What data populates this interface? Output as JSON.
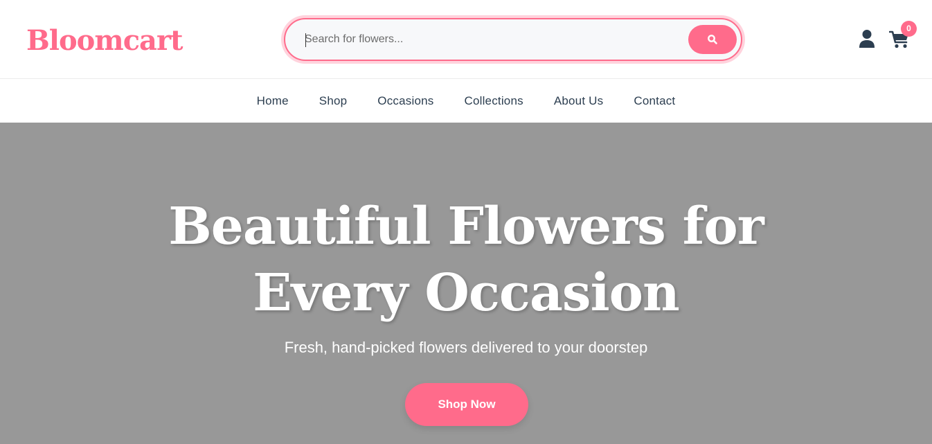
{
  "brand": {
    "logo": "Bloomcart",
    "accent_color": "#ff6b8b"
  },
  "search": {
    "placeholder": "Search for flowers...",
    "value": "",
    "button_icon": "search-icon"
  },
  "header_icons": {
    "user": "user-icon",
    "cart": "cart-icon",
    "cart_count": "0"
  },
  "nav": {
    "items": [
      {
        "label": "Home"
      },
      {
        "label": "Shop"
      },
      {
        "label": "Occasions"
      },
      {
        "label": "Collections"
      },
      {
        "label": "About Us"
      },
      {
        "label": "Contact"
      }
    ]
  },
  "hero": {
    "title_line1": "Beautiful Flowers for",
    "title_line2": "Every Occasion",
    "subtitle": "Fresh, hand-picked flowers delivered to your doorstep",
    "cta_label": "Shop Now",
    "background_color": "#989898"
  }
}
